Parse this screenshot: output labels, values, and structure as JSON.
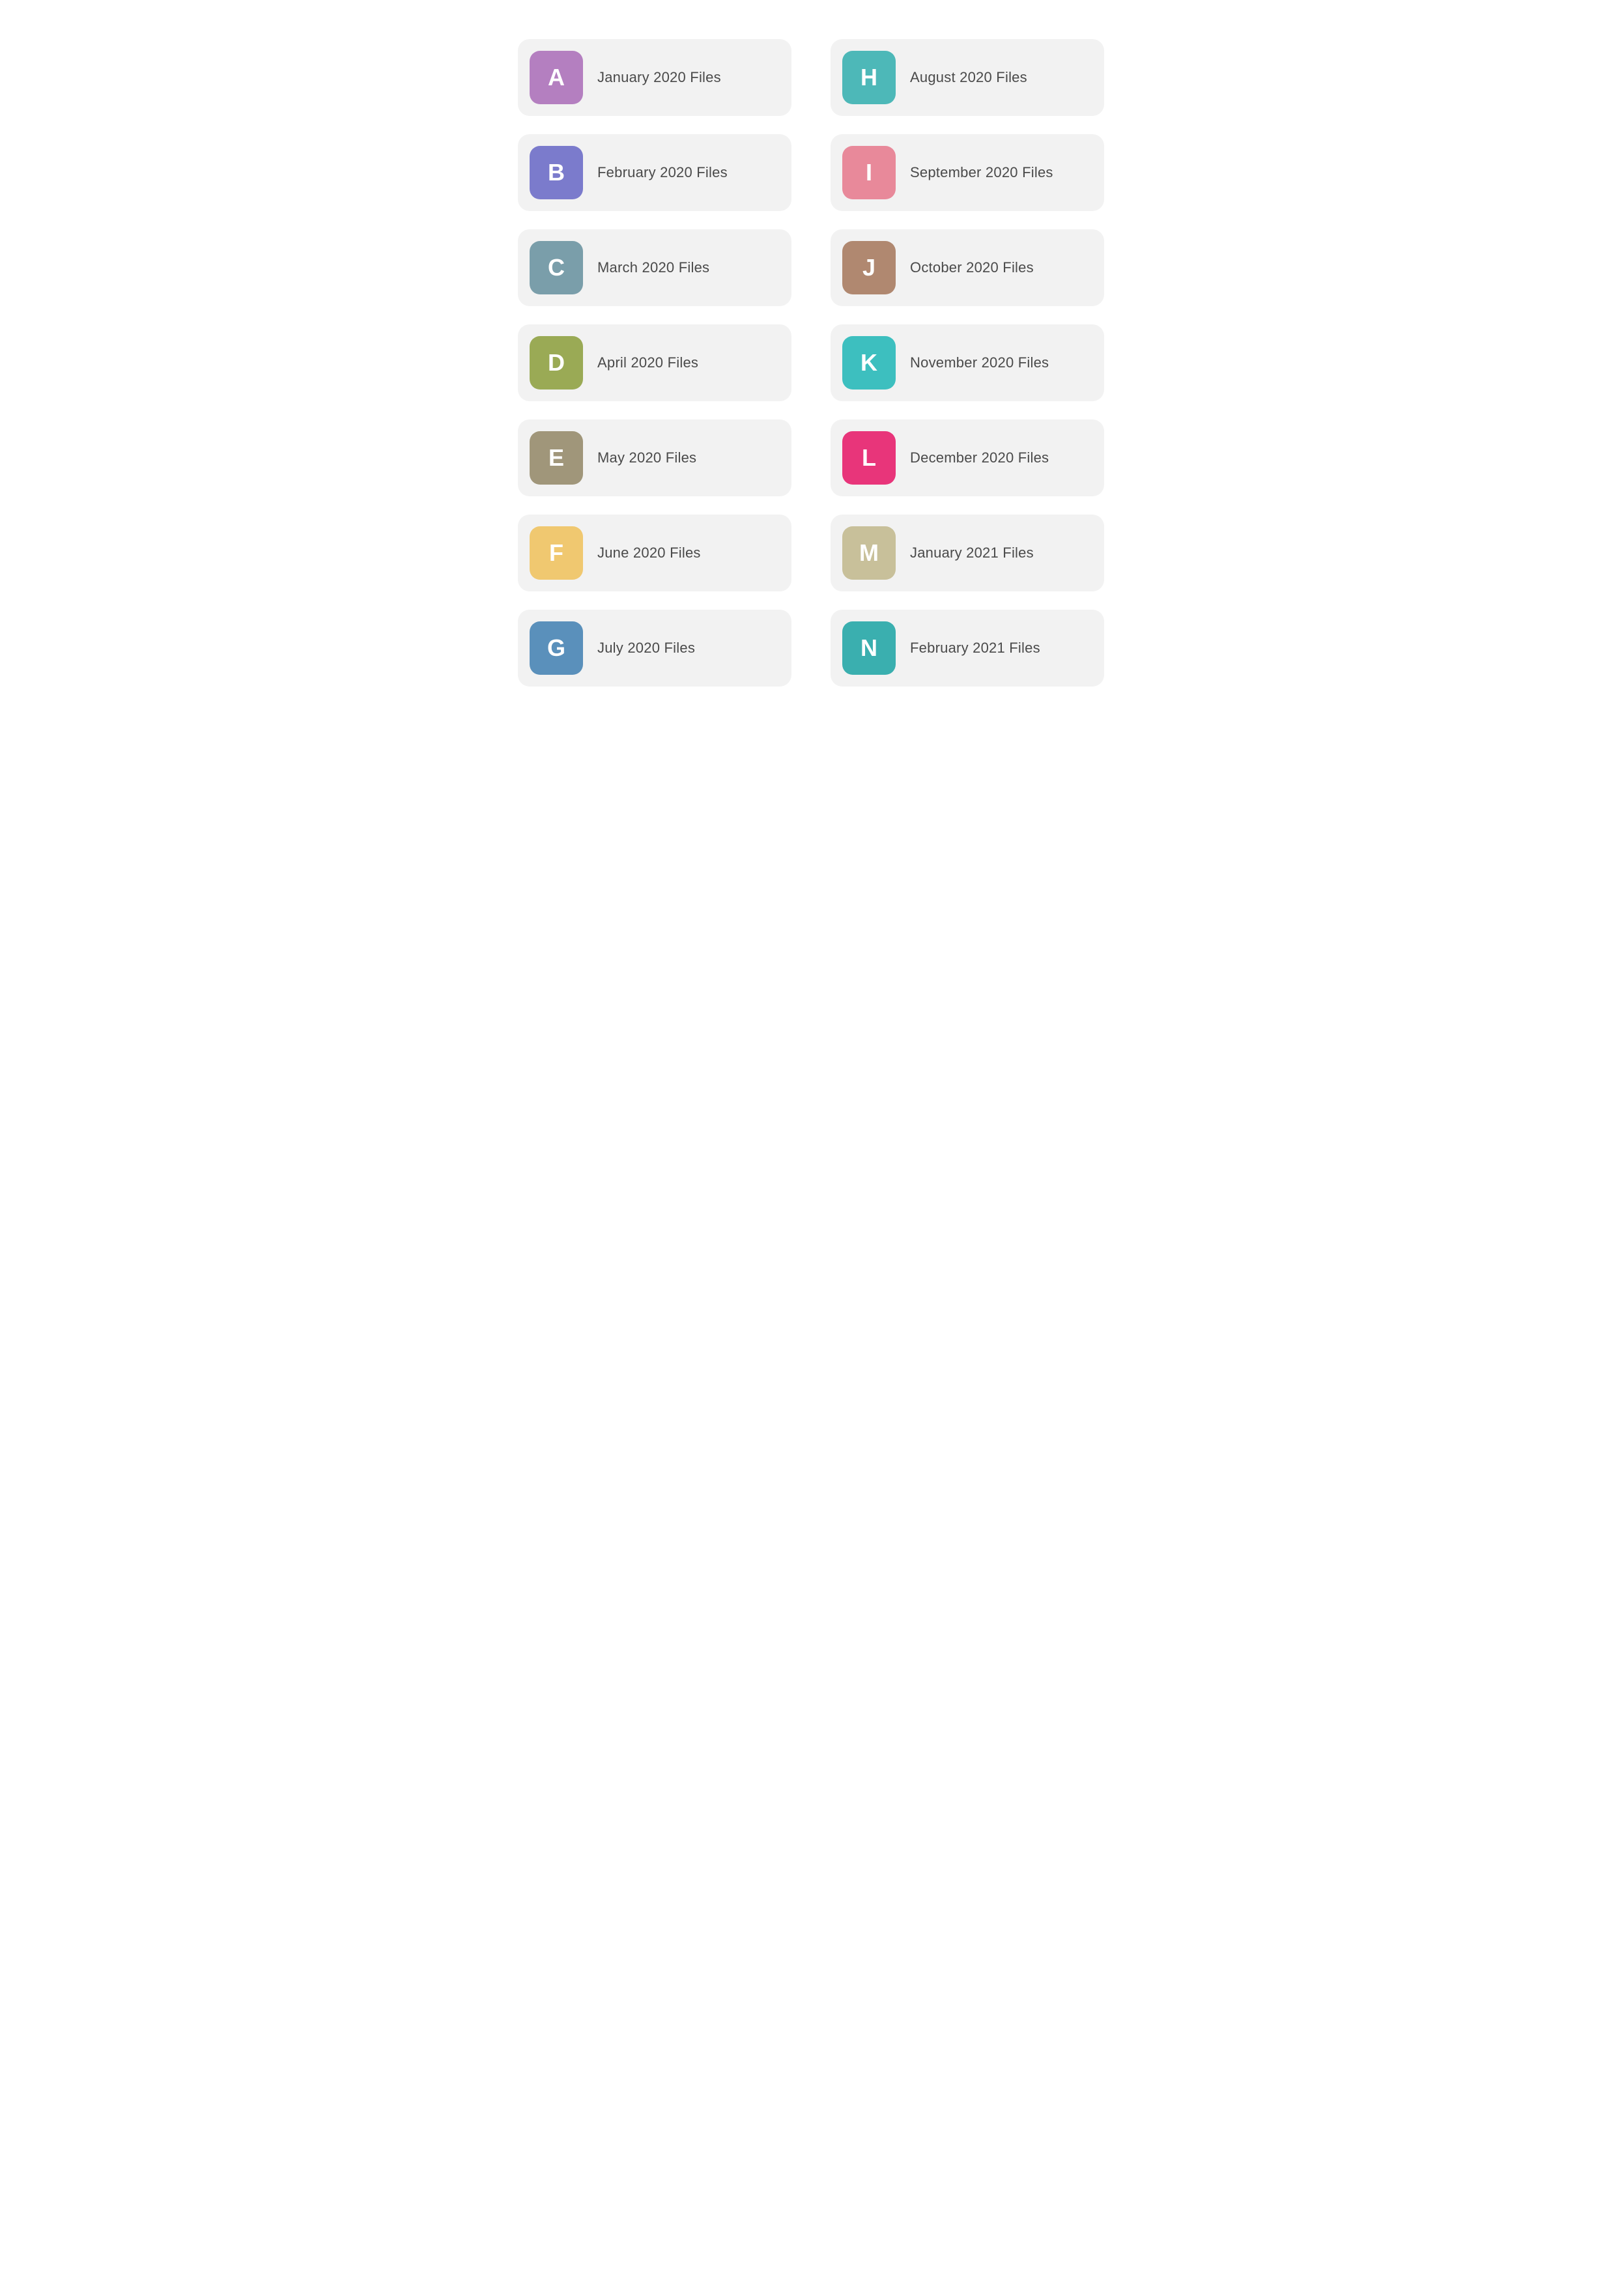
{
  "items": [
    {
      "id": "a",
      "letter": "A",
      "label": "January 2020 Files",
      "color": "#b47fc0"
    },
    {
      "id": "h",
      "letter": "H",
      "label": "August 2020 Files",
      "color": "#4db8b8"
    },
    {
      "id": "b",
      "letter": "B",
      "label": "February 2020 Files",
      "color": "#7b7bcc"
    },
    {
      "id": "i",
      "letter": "I",
      "label": "September 2020 Files",
      "color": "#e8899a"
    },
    {
      "id": "c",
      "letter": "C",
      "label": "March 2020 Files",
      "color": "#7a9eaa"
    },
    {
      "id": "j",
      "letter": "J",
      "label": "October 2020 Files",
      "color": "#b08870"
    },
    {
      "id": "d",
      "letter": "D",
      "label": "April 2020 Files",
      "color": "#9aaa55"
    },
    {
      "id": "k",
      "letter": "K",
      "label": "November 2020 Files",
      "color": "#3dbfbf"
    },
    {
      "id": "e",
      "letter": "E",
      "label": "May 2020 Files",
      "color": "#a0967a"
    },
    {
      "id": "l",
      "letter": "L",
      "label": "December 2020 Files",
      "color": "#e8357a"
    },
    {
      "id": "f",
      "letter": "F",
      "label": "June 2020 Files",
      "color": "#f0c870"
    },
    {
      "id": "m",
      "letter": "M",
      "label": "January 2021 Files",
      "color": "#c8c09a"
    },
    {
      "id": "g",
      "letter": "G",
      "label": "July 2020 Files",
      "color": "#5a90bb"
    },
    {
      "id": "n",
      "letter": "N",
      "label": "February 2021 Files",
      "color": "#3aafaf"
    }
  ]
}
